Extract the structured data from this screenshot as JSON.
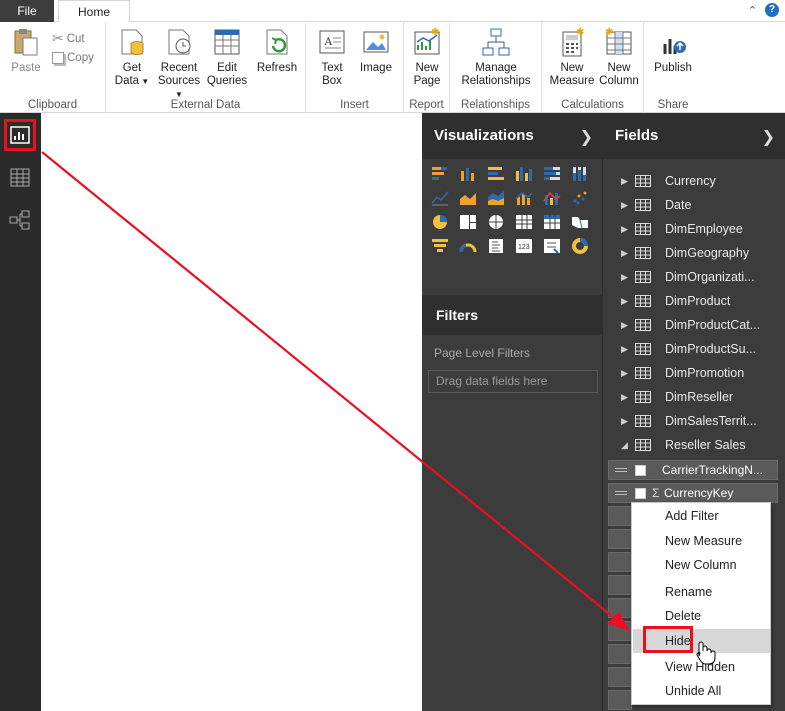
{
  "tabs": {
    "file": "File",
    "home": "Home"
  },
  "ribbon": {
    "clipboard": {
      "label": "Clipboard",
      "paste": "Paste",
      "cut": "Cut",
      "copy": "Copy"
    },
    "external_data": {
      "label": "External Data",
      "get_data": "Get",
      "get_data2": "Data",
      "recent_sources": "Recent",
      "recent_sources2": "Sources",
      "edit_queries": "Edit",
      "edit_queries2": "Queries",
      "refresh": "Refresh"
    },
    "insert": {
      "label": "Insert",
      "text_box": "Text",
      "text_box2": "Box",
      "image": "Image"
    },
    "report": {
      "label": "Report",
      "new_page": "New",
      "new_page2": "Page"
    },
    "relationships": {
      "label": "Relationships",
      "manage": "Manage",
      "manage2": "Relationships"
    },
    "calculations": {
      "label": "Calculations",
      "new_measure": "New",
      "new_measure2": "Measure",
      "new_column": "New",
      "new_column2": "Column"
    },
    "share": {
      "label": "Share",
      "publish": "Publish"
    }
  },
  "visualizations": {
    "title": "Visualizations"
  },
  "filters": {
    "title": "Filters",
    "page_level": "Page Level Filters",
    "drag_placeholder": "Drag data fields here"
  },
  "fields": {
    "title": "Fields",
    "tables": [
      "Currency",
      "Date",
      "DimEmployee",
      "DimGeography",
      "DimOrganizati...",
      "DimProduct",
      "DimProductCat...",
      "DimProductSu...",
      "DimPromotion",
      "DimReseller",
      "DimSalesTerrit...",
      "Reseller Sales"
    ],
    "expanded_fields": [
      {
        "name": "CarrierTrackingN...",
        "sigma": ""
      },
      {
        "name": "CurrencyKey",
        "sigma": "Σ"
      }
    ]
  },
  "context_menu": {
    "items": [
      "Add Filter",
      "New Measure",
      "New Column",
      "Rename",
      "Delete",
      "Hide",
      "View Hidden",
      "Unhide All"
    ],
    "highlighted": "Hide"
  },
  "colors": {
    "highlight_red": "#e81123",
    "pane_dark": "#3c3c3c",
    "rail_dark": "#2b2b2b"
  }
}
